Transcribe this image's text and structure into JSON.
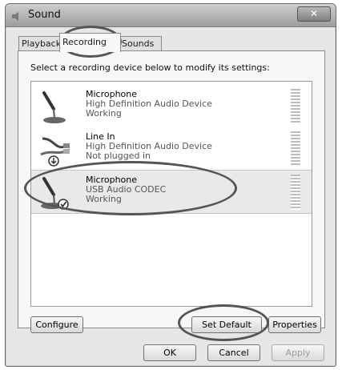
{
  "window": {
    "title": "Sound"
  },
  "tabs": [
    {
      "label": "Playback",
      "active": false
    },
    {
      "label": "Recording",
      "active": true
    },
    {
      "label": "Sounds",
      "active": false
    }
  ],
  "instruction": "Select a recording device below to modify its settings:",
  "devices": [
    {
      "name": "Microphone",
      "description": "High Definition Audio Device",
      "status": "Working",
      "icon": "microphone-icon",
      "selected": false
    },
    {
      "name": "Line In",
      "description": "High Definition Audio Device",
      "status": "Not plugged in",
      "icon": "line-in-cable-icon",
      "selected": false
    },
    {
      "name": "Microphone",
      "description": "USB Audio CODEC",
      "status": "Working",
      "icon": "microphone-default-check-icon",
      "selected": true
    }
  ],
  "buttons": {
    "configure": "Configure",
    "set_default": "Set Default",
    "properties": "Properties",
    "ok": "OK",
    "cancel": "Cancel",
    "apply": "Apply"
  },
  "colors": {
    "accent": "#555555",
    "selection": "#e9e9e9"
  }
}
